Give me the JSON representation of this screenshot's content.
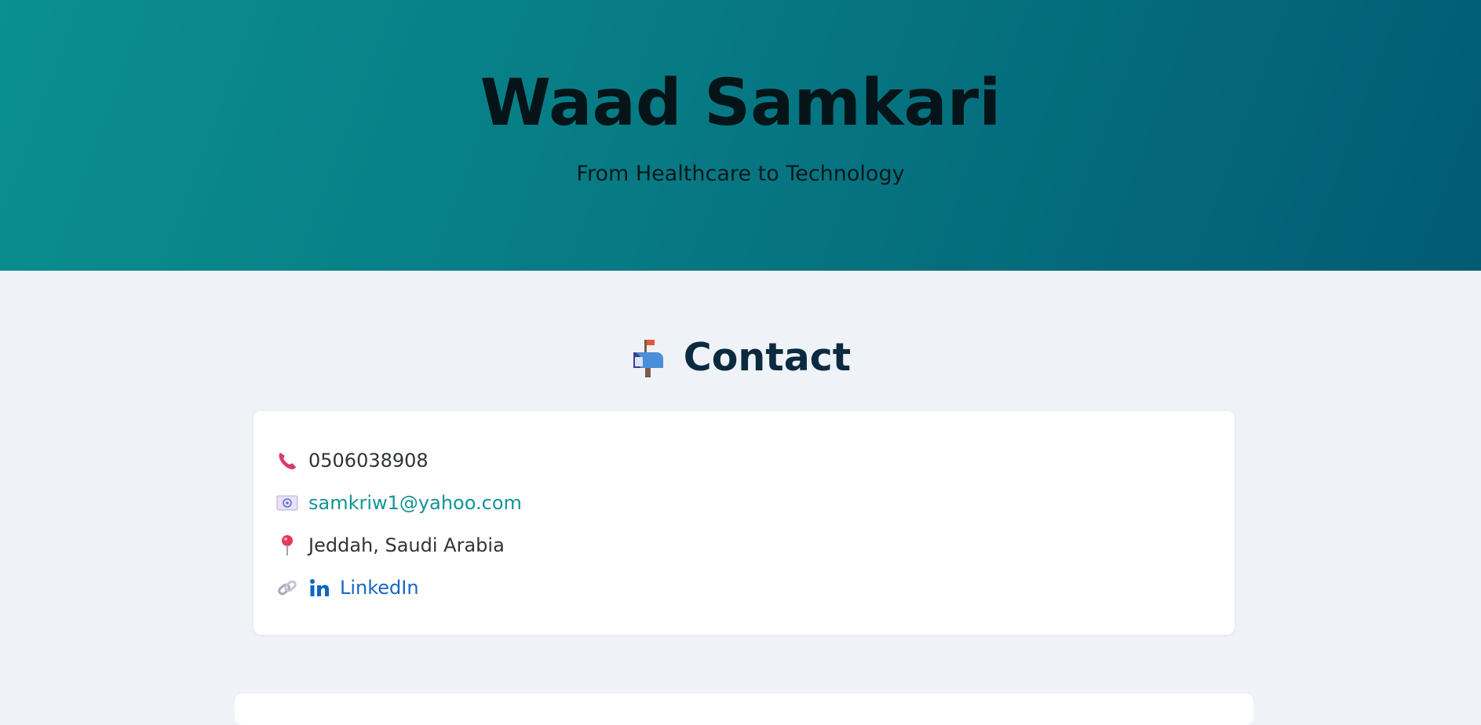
{
  "hero": {
    "title": "Waad Samkari",
    "subtitle": "From Healthcare to Technology"
  },
  "contact": {
    "heading": "Contact",
    "heading_icon": "mailbox-icon",
    "phone": "0506038908",
    "email": "samkriw1@yahoo.com",
    "location": "Jeddah, Saudi Arabia",
    "linkedin_label": "LinkedIn"
  },
  "colors": {
    "hero_gradient_start": "#0b8f8f",
    "hero_gradient_end": "#025b73",
    "email_link": "#149494",
    "linkedin_link": "#1766c2",
    "heading": "#0b2a40",
    "page_background": "#eff3f8"
  }
}
